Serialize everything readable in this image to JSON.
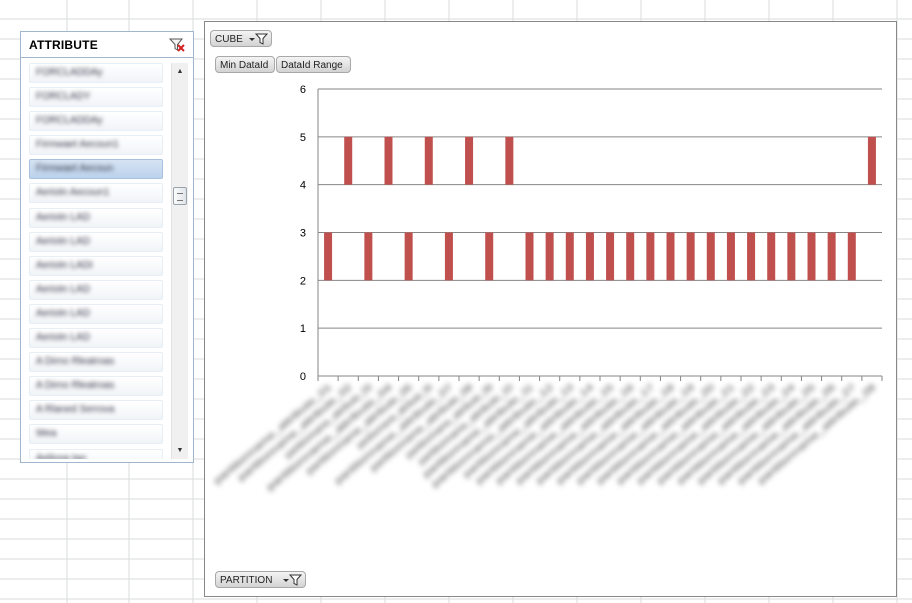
{
  "slicer": {
    "title": "ATTRIBUTE",
    "clear_filter_icon": "clear-filter-icon",
    "items": [
      {
        "label": "FORCLADDAy",
        "selected": false
      },
      {
        "label": "FORCLADY",
        "selected": false
      },
      {
        "label": "FORCLADDAy",
        "selected": false
      },
      {
        "label": "Firmwaet Aecoun1",
        "selected": false
      },
      {
        "label": "Firmwaet Aecoun",
        "selected": true
      },
      {
        "label": "Aeriotn Aecoun1",
        "selected": false
      },
      {
        "label": "Aeriotn LAD",
        "selected": false
      },
      {
        "label": "Aeriotn LAD",
        "selected": false
      },
      {
        "label": "Aeriotn LADI",
        "selected": false
      },
      {
        "label": "Aeriotn LAD",
        "selected": false
      },
      {
        "label": "Aeriotn LAD",
        "selected": false
      },
      {
        "label": "Aeriotn LAD",
        "selected": false
      },
      {
        "label": "A Dirno Rleatroas",
        "selected": false
      },
      {
        "label": "A Dirno Rleatroas",
        "selected": false
      },
      {
        "label": "A Rlaned Serrova",
        "selected": false
      },
      {
        "label": "Wea",
        "selected": false
      },
      {
        "label": "Aelinoa tao",
        "selected": false
      }
    ],
    "scroll_up_glyph": "▲",
    "scroll_down_glyph": "▼"
  },
  "chart_fields": {
    "cube": "CUBE",
    "min_dataid": "Min DataId",
    "dataid_range": "DataId Range",
    "partition": "PARTITION",
    "filter_icon": "filter-dropdown-icon"
  },
  "colors": {
    "bar": "#c0504d",
    "grid": "#868686",
    "slicer_border": "#9fb6cd",
    "selected_item": "#bcd2ec"
  },
  "chart_data": {
    "type": "bar",
    "subtype": "floating-range (stacked, base hidden)",
    "grid": true,
    "legend": "none",
    "ylim": [
      0,
      6
    ],
    "yticks": [
      0,
      1,
      2,
      3,
      4,
      5,
      6
    ],
    "series": [
      {
        "name": "Min DataId",
        "hidden": true,
        "values": [
          2,
          4,
          2,
          4,
          2,
          4,
          2,
          4,
          2,
          4,
          2,
          2,
          2,
          2,
          2,
          2,
          2,
          2,
          2,
          2,
          2,
          2,
          2,
          2,
          2,
          2,
          2,
          4
        ]
      },
      {
        "name": "DataId Range",
        "values": [
          1,
          1,
          1,
          1,
          1,
          1,
          1,
          1,
          1,
          1,
          1,
          1,
          1,
          1,
          1,
          1,
          1,
          1,
          1,
          1,
          1,
          1,
          1,
          1,
          1,
          1,
          1,
          1
        ]
      }
    ],
    "categories": [
      "partitionname_attribute_01",
      "partitionname_attribute_02",
      "partitionname_attribute_03",
      "partitionname_attribute_04",
      "partitionname_attribute_05",
      "partitionname_attribute_06",
      "partitionname_attribute_07",
      "partitionname_attribute_08",
      "partitionname_attribute_09",
      "partitionname_attribute_10",
      "partitionname_attribute_11",
      "partitionname_attribute_12",
      "partitionname_attribute_13",
      "partitionname_attribute_14",
      "partitionname_attribute_15",
      "partitionname_attribute_16",
      "partitionname_attribute_17",
      "partitionname_attribute_18",
      "partitionname_attribute_19",
      "partitionname_attribute_20",
      "partitionname_attribute_21",
      "partitionname_attribute_22",
      "partitionname_attribute_23",
      "partitionname_attribute_24",
      "partitionname_attribute_25",
      "partitionname_attribute_26",
      "partitionname_attribute_27",
      "partitionname_attribute_28"
    ],
    "categories_legible": false
  }
}
